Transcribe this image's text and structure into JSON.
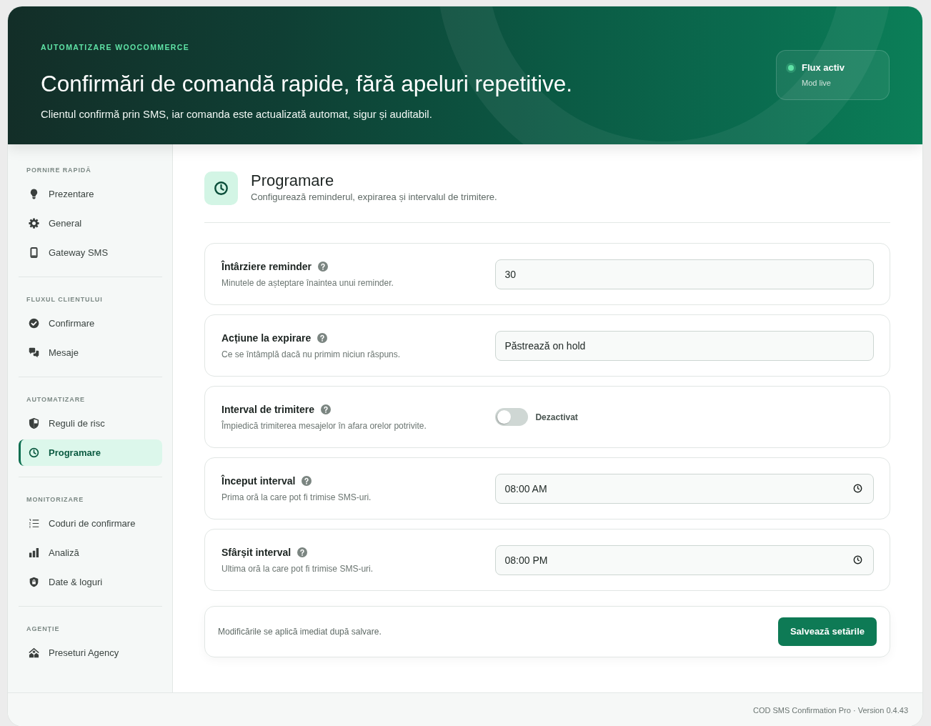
{
  "header": {
    "eyebrow": "AUTOMATIZARE WOOCOMMERCE",
    "title": "Confirmări de comandă rapide, fără apeluri repetitive.",
    "subtitle": "Clientul confirmă prin SMS, iar comanda este actualizată automat, sigur și auditabil.",
    "status": {
      "title": "Flux activ",
      "subtitle": "Mod live"
    }
  },
  "sidebar": {
    "sections": [
      {
        "heading": "PORNIRE RAPIDĂ",
        "items": [
          {
            "label": "Prezentare",
            "selected": false
          },
          {
            "label": "General",
            "selected": false
          },
          {
            "label": "Gateway SMS",
            "selected": false
          }
        ]
      },
      {
        "heading": "FLUXUL CLIENTULUI",
        "items": [
          {
            "label": "Confirmare",
            "selected": false
          },
          {
            "label": "Mesaje",
            "selected": false
          }
        ]
      },
      {
        "heading": "AUTOMATIZARE",
        "items": [
          {
            "label": "Reguli de risc",
            "selected": false
          },
          {
            "label": "Programare",
            "selected": true
          }
        ]
      },
      {
        "heading": "MONITORIZARE",
        "items": [
          {
            "label": "Coduri de confirmare",
            "selected": false
          },
          {
            "label": "Analiză",
            "selected": false
          },
          {
            "label": "Date & loguri",
            "selected": false
          }
        ]
      },
      {
        "heading": "AGENȚIE",
        "items": [
          {
            "label": "Preseturi Agency",
            "selected": false
          }
        ]
      }
    ]
  },
  "page": {
    "title": "Programare",
    "subtitle": "Configurează reminderul, expirarea și intervalul de trimitere."
  },
  "settings": [
    {
      "kind": "number",
      "label": "Întârziere reminder",
      "description": "Minutele de așteptare înaintea unui reminder.",
      "value": "30"
    },
    {
      "kind": "select",
      "label": "Acțiune la expirare",
      "description": "Ce se întâmplă dacă nu primim niciun răspuns.",
      "value": "Păstrează on hold"
    },
    {
      "kind": "toggle",
      "label": "Interval de trimitere",
      "description": "Împiedică trimiterea mesajelor în afara orelor potrivite.",
      "on": false,
      "state_label": "Dezactivat"
    },
    {
      "kind": "time",
      "label": "Început interval",
      "description": "Prima oră la care pot fi trimise SMS-uri.",
      "value": "08:00 AM"
    },
    {
      "kind": "time",
      "label": "Sfârșit interval",
      "description": "Ultima oră la care pot fi trimise SMS-uri.",
      "value": "08:00 PM"
    }
  ],
  "save_bar": {
    "note": "Modificările se aplică imediat după salvare.",
    "button": "Salvează setările"
  },
  "footer": {
    "text": "COD SMS Confirmation Pro · Version 0.4.43"
  }
}
